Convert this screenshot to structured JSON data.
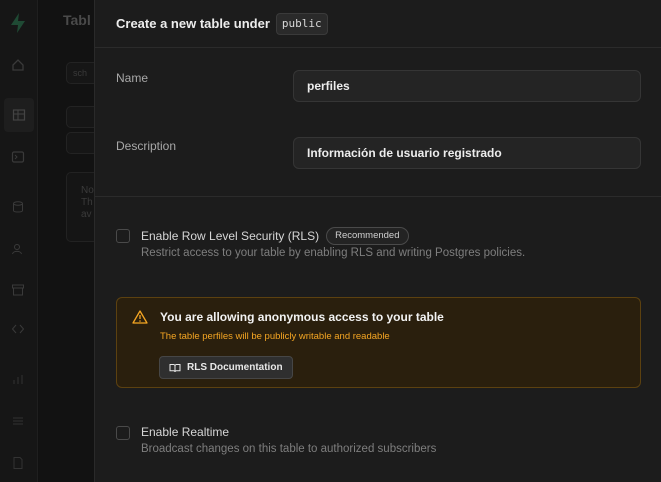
{
  "background": {
    "page_title_fragment": "Tabl",
    "note_lines": [
      "No",
      "Th",
      "av"
    ],
    "filter_placeholder": "sch"
  },
  "rail": {
    "icons": [
      "supabase-logo-icon",
      "home-icon",
      "table-editor-icon",
      "sql-editor-icon",
      "database-icon",
      "auth-icon",
      "storage-icon",
      "edge-functions-icon",
      "reports-icon",
      "logs-icon",
      "docs-icon"
    ]
  },
  "sheet": {
    "title": "Create a new table under",
    "schema": "public",
    "name_label": "Name",
    "name_value": "perfiles",
    "description_label": "Description",
    "description_value": "Información de usuario registrado",
    "rls": {
      "title": "Enable Row Level Security (RLS)",
      "badge": "Recommended",
      "description": "Restrict access to your table by enabling RLS and writing Postgres policies.",
      "checked": false
    },
    "warning": {
      "title": "You are allowing anonymous access to your table",
      "subtitle": "The table perfiles will be publicly writable and readable",
      "button": "RLS Documentation",
      "accent_color": "#f5a623"
    },
    "realtime": {
      "title": "Enable Realtime",
      "description": "Broadcast changes on this table to authorized subscribers",
      "checked": false
    }
  }
}
